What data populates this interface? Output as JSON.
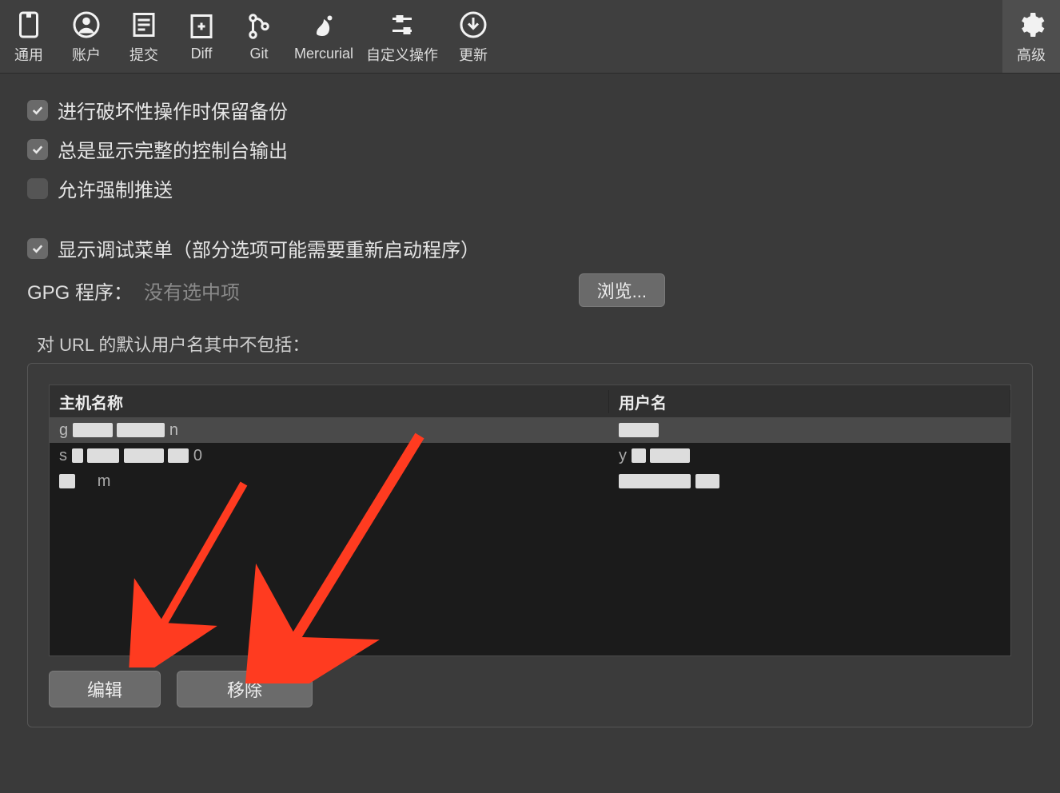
{
  "toolbar": {
    "general": "通用",
    "accounts": "账户",
    "commit": "提交",
    "diff": "Diff",
    "git": "Git",
    "mercurial": "Mercurial",
    "custom_actions": "自定义操作",
    "update": "更新",
    "advanced": "高级"
  },
  "checkboxes": {
    "backup_destructive": "进行破坏性操作时保留备份",
    "full_console_output": "总是显示完整的控制台输出",
    "allow_force_push": "允许强制推送",
    "show_debug_menu": "显示调试菜单（部分选项可能需要重新启动程序）"
  },
  "gpg": {
    "label": "GPG 程序：",
    "value": "没有选中项",
    "browse": "浏览..."
  },
  "url_section": {
    "title": "对 URL 的默认用户名其中不包括：",
    "columns": {
      "host": "主机名称",
      "user": "用户名"
    },
    "rows": [
      {
        "host": "g██████.███n",
        "user": "████",
        "selected": true
      },
      {
        "host": "s██ ████ ███ █0",
        "user": "y██ ████",
        "selected": false
      },
      {
        "host": "███m",
        "user": "██████████",
        "selected": false
      }
    ],
    "edit_btn": "编辑",
    "remove_btn": "移除"
  }
}
